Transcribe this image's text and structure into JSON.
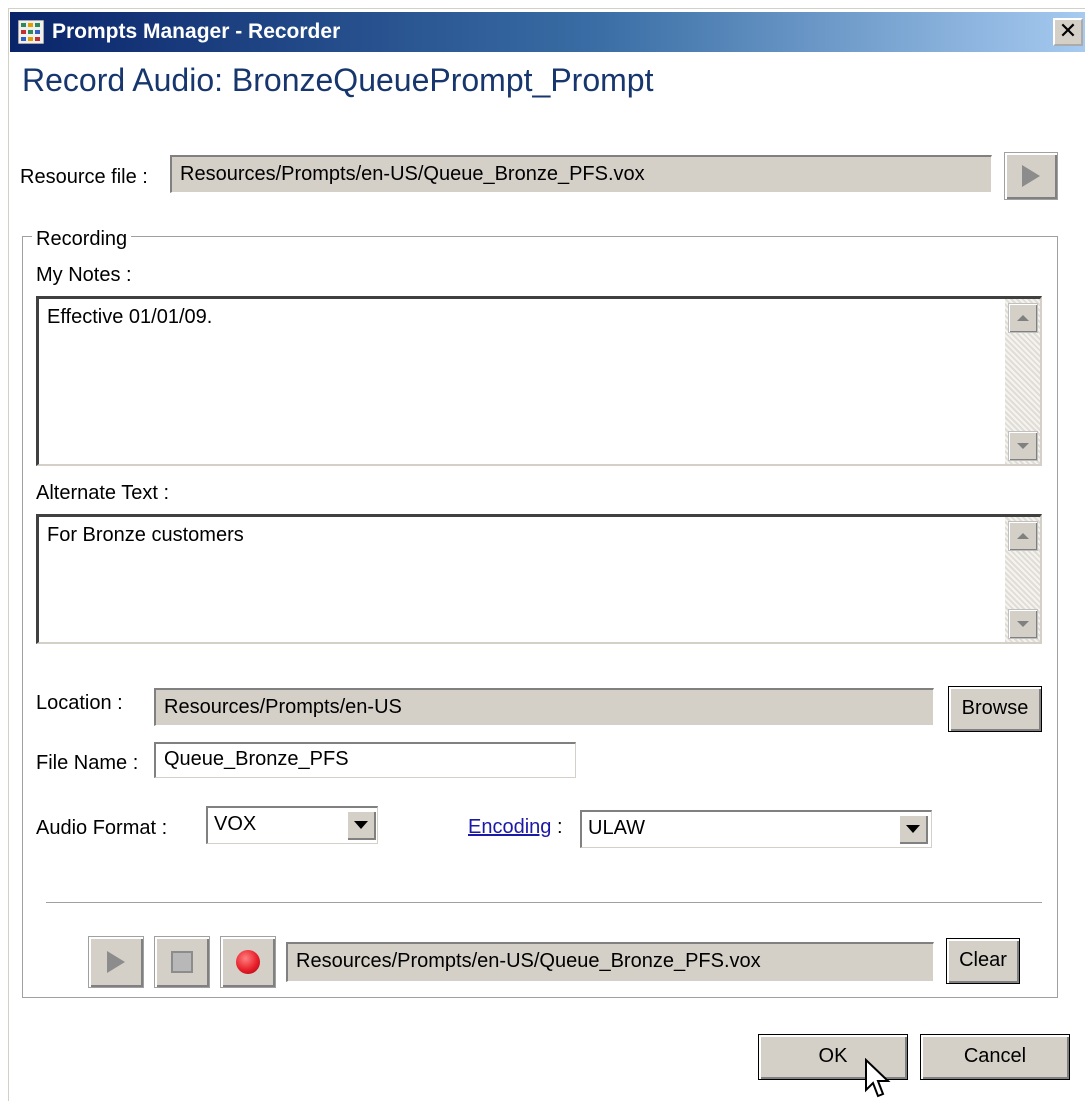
{
  "window": {
    "title": "Prompts Manager - Recorder",
    "close_label": "✕",
    "icon": "app-grid-icon"
  },
  "page_title": "Record Audio: BronzeQueuePrompt_Prompt",
  "resource_file": {
    "label": "Resource file :",
    "value": "Resources/Prompts/en-US/Queue_Bronze_PFS.vox",
    "play_icon": "play-icon"
  },
  "recording": {
    "group_label": "Recording",
    "notes_label": "My Notes :",
    "notes_value": "Effective 01/01/09.",
    "alt_label": "Alternate Text :",
    "alt_value": "For Bronze customers",
    "location_label": "Location :",
    "location_value": "Resources/Prompts/en-US",
    "browse_label": "Browse",
    "filename_label": "File Name :",
    "filename_value": "Queue_Bronze_PFS",
    "audio_format_label": "Audio Format :",
    "audio_format_value": "VOX",
    "encoding_link": "Encoding",
    "encoding_colon": ":",
    "encoding_value": "ULAW",
    "playback_path": "Resources/Prompts/en-US/Queue_Bronze_PFS.vox",
    "clear_label": "Clear",
    "icons": [
      "play-icon",
      "stop-icon",
      "record-icon"
    ]
  },
  "footer": {
    "ok_label": "OK",
    "cancel_label": "Cancel"
  },
  "colors": {
    "title_gradient_start": "#0a246a",
    "page_title": "#17366e",
    "link": "#1a1aa6",
    "record_red": "#e8202a",
    "control_face": "#d4d0c8"
  }
}
